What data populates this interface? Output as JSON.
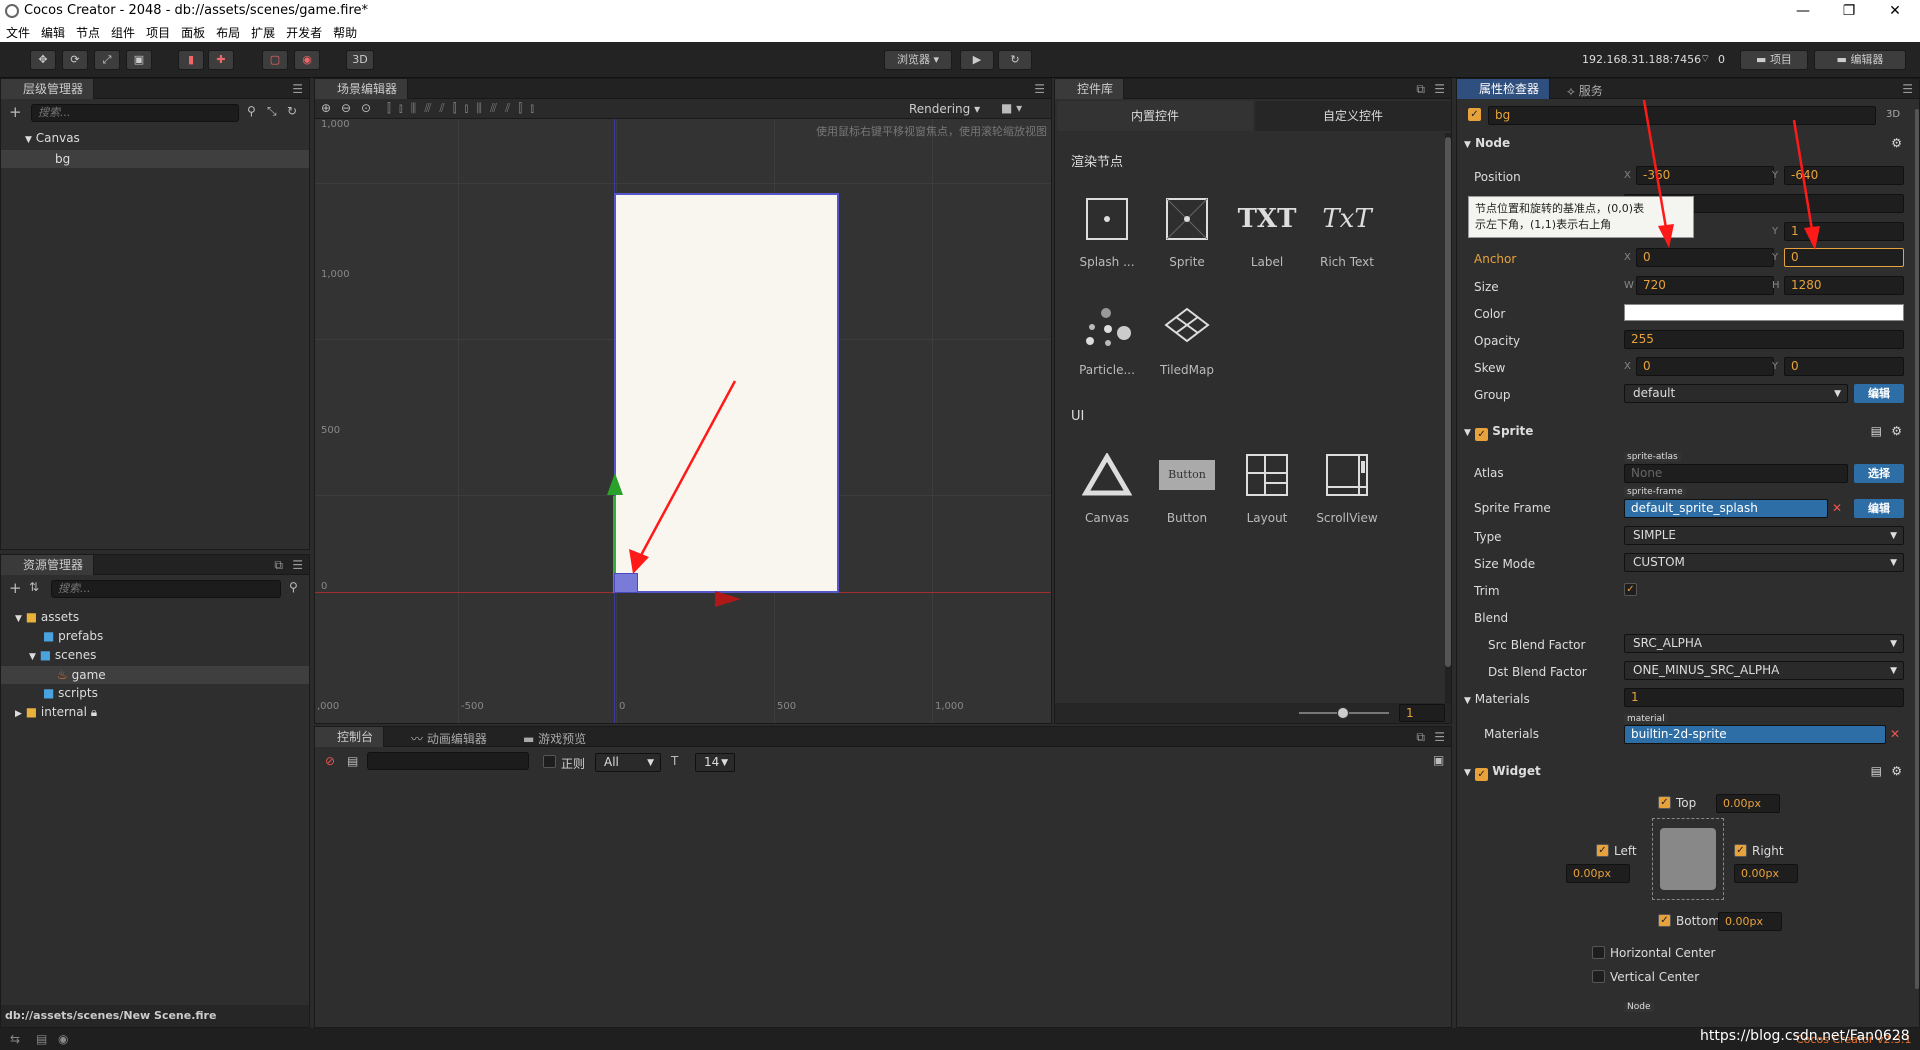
{
  "window": {
    "title": "Cocos Creator - 2048 - db://assets/scenes/game.fire*",
    "min": "—",
    "max": "❐",
    "close": "✕"
  },
  "menu": [
    "文件",
    "编辑",
    "节点",
    "组件",
    "项目",
    "面板",
    "布局",
    "扩展",
    "开发者",
    "帮助"
  ],
  "toolbar": {
    "mode3d": "3D",
    "browser": "浏览器",
    "ip": "192.168.31.188:7456",
    "wifi_count": "0",
    "project_btn": "项目",
    "editor_btn": "编辑器"
  },
  "hierarchy": {
    "tab": "层级管理器",
    "search_placeholder": "搜索...",
    "canvas": "Canvas",
    "bg": "bg"
  },
  "assets": {
    "tab": "资源管理器",
    "search_placeholder": "搜索...",
    "items": [
      "assets",
      "prefabs",
      "scenes",
      "game",
      "scripts",
      "internal"
    ],
    "footer": "db://assets/scenes/New Scene.fire"
  },
  "scene": {
    "tab": "场景编辑器",
    "rendering": "Rendering",
    "hint": "使用鼠标右键平移视窗焦点，使用滚轮缩放视图",
    "y_ticks": [
      "1,000",
      "500",
      "0"
    ],
    "x_ticks": [
      ",000",
      "-500",
      "0",
      "500",
      "1,000"
    ],
    "top_tick": "1,000"
  },
  "library": {
    "tab": "控件库",
    "tab_builtin": "内置控件",
    "tab_custom": "自定义控件",
    "render_section": "渲染节点",
    "ui_section": "UI",
    "render_items": [
      "Splash ...",
      "Sprite",
      "Label",
      "Rich Text",
      "Particle...",
      "TiledMap"
    ],
    "ui_items": [
      "Canvas",
      "Button",
      "Layout",
      "ScrollView"
    ],
    "txt_glyph": "TXT",
    "rtxt_glyph": "TxT",
    "button_glyph": "Button",
    "zoom_value": "1"
  },
  "console": {
    "tab_console": "控制台",
    "tab_anim": "动画编辑器",
    "tab_preview": "游戏预览",
    "regex": "正则",
    "filter": "All",
    "fontsize": "14"
  },
  "inspector": {
    "tab": "属性检查器",
    "tab_service": "服务",
    "node_name": "bg",
    "mode3d": "3D",
    "node_section": "Node",
    "tooltip": [
      "节点位置和旋转的基准点，(0,0)表",
      "示左下角，(1,1)表示右上角"
    ],
    "position": {
      "label": "Position",
      "x": "-360",
      "y": "-640"
    },
    "scale": {
      "y": "1"
    },
    "anchor": {
      "label": "Anchor",
      "x": "0",
      "y": "0"
    },
    "size": {
      "label": "Size",
      "w": "720",
      "h": "1280"
    },
    "color": {
      "label": "Color",
      "value": "#ffffff"
    },
    "opacity": {
      "label": "Opacity",
      "value": "255"
    },
    "skew": {
      "label": "Skew",
      "x": "0",
      "y": "0"
    },
    "group": {
      "label": "Group",
      "value": "default",
      "btn": "编辑"
    },
    "sprite_section": "Sprite",
    "atlas": {
      "label": "Atlas",
      "tag": "sprite-atlas",
      "value": "None",
      "btn": "选择"
    },
    "sprite_frame": {
      "label": "Sprite Frame",
      "tag": "sprite-frame",
      "value": "default_sprite_splash",
      "btn": "编辑"
    },
    "type": {
      "label": "Type",
      "value": "SIMPLE"
    },
    "size_mode": {
      "label": "Size Mode",
      "value": "CUSTOM"
    },
    "trim": {
      "label": "Trim"
    },
    "blend": {
      "label": "Blend"
    },
    "src_blend": {
      "label": "Src Blend Factor",
      "value": "SRC_ALPHA"
    },
    "dst_blend": {
      "label": "Dst Blend Factor",
      "value": "ONE_MINUS_SRC_ALPHA"
    },
    "materials_section": "Materials",
    "materials_count": "1",
    "materials": {
      "label": "Materials",
      "tag": "material",
      "value": "builtin-2d-sprite"
    },
    "widget_section": "Widget",
    "widget": {
      "top": "Top",
      "left": "Left",
      "right": "Right",
      "bottom": "Bottom",
      "top_v": "0.00px",
      "left_v": "0.00px",
      "right_v": "0.00px",
      "bottom_v": "0.00px",
      "hcenter": "Horizontal Center",
      "vcenter": "Vertical Center",
      "node_tag": "Node"
    },
    "axes": {
      "x": "X",
      "y": "Y",
      "w": "W",
      "h": "H"
    }
  },
  "footer": {
    "version": "Cocos Creator v2.3.1",
    "watermark": "https://blog.csdn.net/Fan0628"
  }
}
